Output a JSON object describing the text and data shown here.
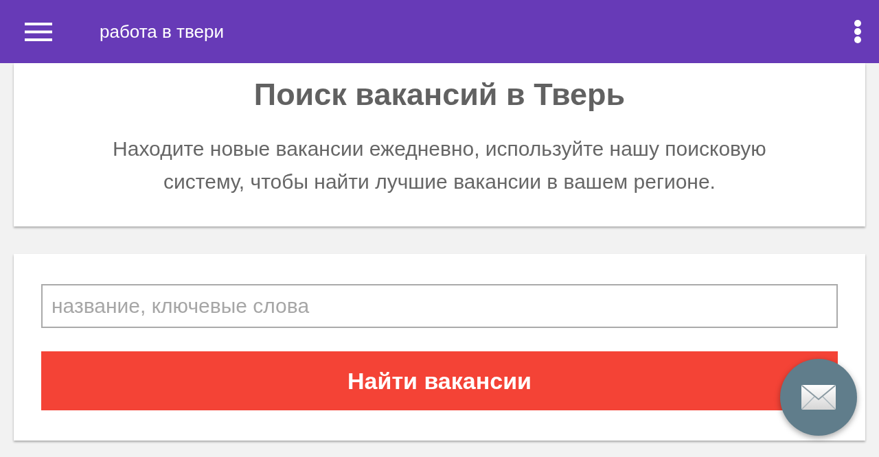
{
  "app_bar": {
    "title": "работа в твери"
  },
  "intro": {
    "title": "Поиск вакансий в Тверь",
    "description": "Находите новые вакансии ежедневно, используйте нашу поисковую систему, чтобы найти лучшие вакансии в вашем регионе."
  },
  "search": {
    "placeholder": "название, ключевые слова",
    "button": "Найти вакансии"
  }
}
